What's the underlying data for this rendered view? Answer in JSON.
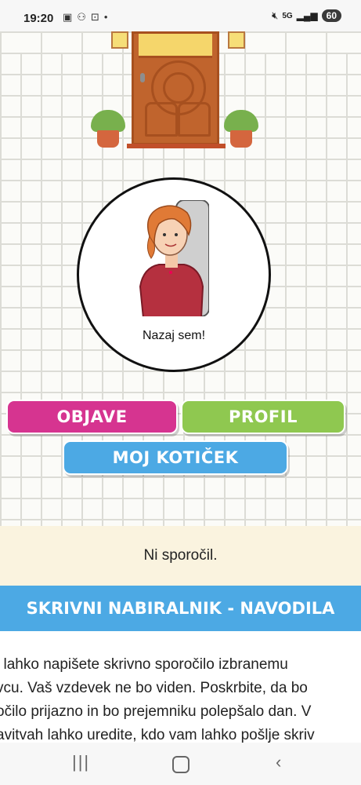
{
  "status_bar": {
    "time": "19:20",
    "left_icons": [
      "app-icon-1",
      "app-icon-2",
      "screenshot-icon",
      "dot-icon"
    ],
    "network": "5G",
    "battery": "60"
  },
  "hero": {
    "caption": "Nazaj sem!"
  },
  "nav_buttons": {
    "objave": "OBJAVE",
    "profil": "PROFIL",
    "moj_koticek": "MOJ KOTIČEK"
  },
  "messages": {
    "empty_text": "Ni sporočil."
  },
  "instructions": {
    "header": "SKRIVNI NABIRALNIK - NAVODILA",
    "lines": [
      "j lahko napišete skrivno sporočilo izbranemu",
      "vcu. Vaš vzdevek ne bo viden. Poskrbite, da bo",
      "očilo prijazno in bo prejemniku polepšalo dan. V",
      "avitvah lahko uredite, kdo vam lahko pošlje skriv"
    ]
  },
  "colors": {
    "objave": "#d63490",
    "profil": "#8fc850",
    "koticek": "#4ca9e4",
    "messages_bg": "#faf3df"
  },
  "system_nav": {
    "recents": "|||",
    "back": "‹"
  }
}
